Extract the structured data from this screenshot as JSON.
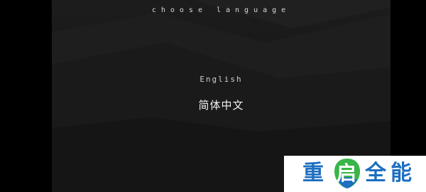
{
  "screen": {
    "title": "choose language",
    "options": [
      {
        "label": "English"
      },
      {
        "label": "简体中文"
      }
    ]
  },
  "watermark": {
    "chars": [
      "重",
      "启",
      "全",
      "能"
    ],
    "brand_blue": "#1d6fc0",
    "brand_green": "#39b54a"
  },
  "colors": {
    "background": "#1a1a1a",
    "text": "#d8d8d8"
  }
}
